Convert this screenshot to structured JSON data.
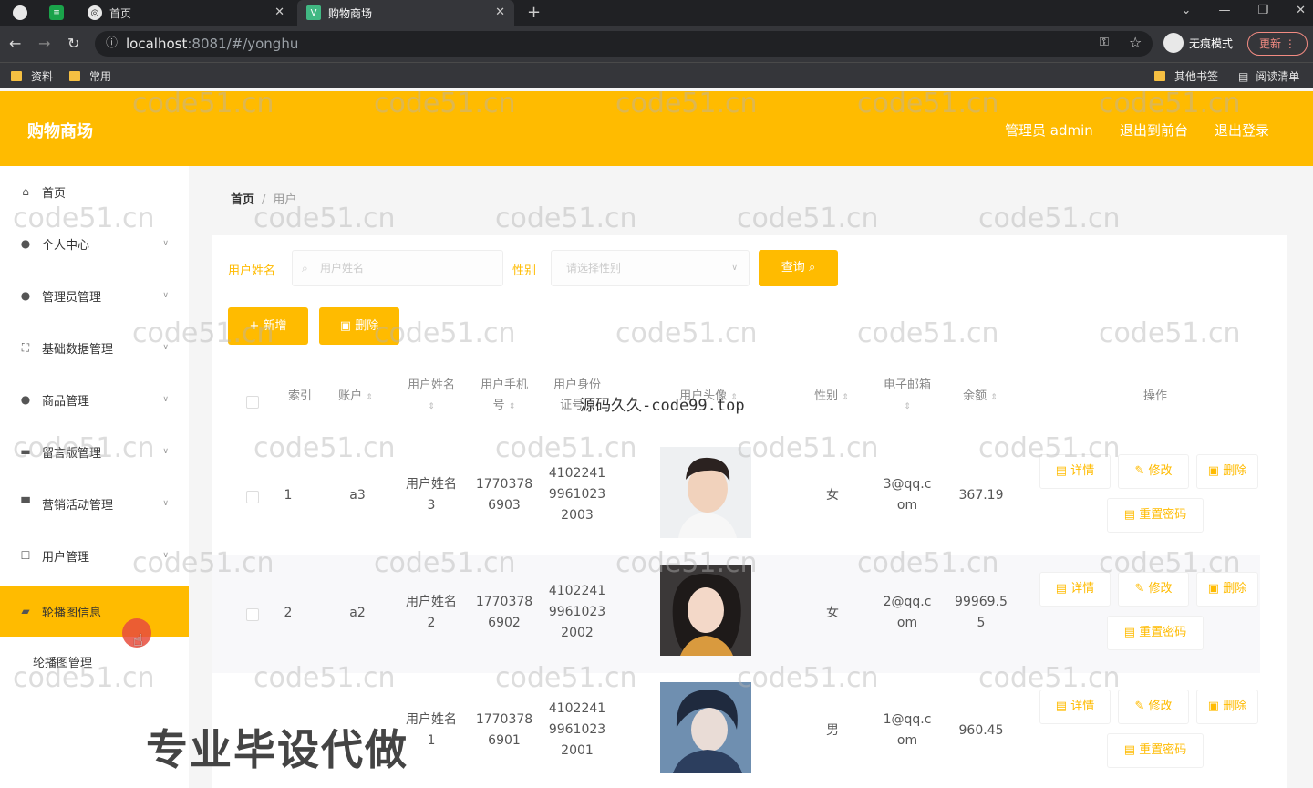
{
  "browser": {
    "tab_home": "首页",
    "tab_active": "购物商场",
    "url_host": "localhost",
    "url_rest": ":8081/#/yonghu",
    "incognito": "无痕模式",
    "update": "更新",
    "bookmarks": [
      "资料",
      "常用"
    ],
    "bookmarks_right": [
      "其他书签",
      "阅读清单"
    ]
  },
  "header": {
    "title": "购物商场",
    "admin": "管理员 admin",
    "to_front": "退出到前台",
    "logout": "退出登录"
  },
  "sidebar": {
    "items": [
      {
        "label": "首页",
        "icon": "home-icon"
      },
      {
        "label": "个人中心",
        "icon": "user-icon"
      },
      {
        "label": "管理员管理",
        "icon": "user-icon"
      },
      {
        "label": "基础数据管理",
        "icon": "expand-icon"
      },
      {
        "label": "商品管理",
        "icon": "user-icon"
      },
      {
        "label": "留言版管理",
        "icon": "message-icon"
      },
      {
        "label": "营销活动管理",
        "icon": "monitor-icon"
      },
      {
        "label": "用户管理",
        "icon": "square-icon"
      },
      {
        "label": "轮播图信息",
        "icon": "bag-icon"
      }
    ],
    "sub_item": "轮播图管理"
  },
  "breadcrumb": {
    "home": "首页",
    "sep": "/",
    "current": "用户"
  },
  "search": {
    "name_label": "用户姓名",
    "name_placeholder": "用户姓名",
    "gender_label": "性别",
    "gender_placeholder": "请选择性别",
    "query": "查询"
  },
  "actions": {
    "add": "+ 新增",
    "delete": "删除"
  },
  "table": {
    "headers": [
      "索引",
      "账户",
      "用户姓名",
      "用户手机号",
      "用户身份证号",
      "用户头像",
      "性别",
      "电子邮箱",
      "余额",
      "操作"
    ],
    "header_lines": {
      "name": [
        "用户姓名"
      ],
      "phone": [
        "用户手机",
        "号"
      ],
      "idcard": [
        "用户身份",
        "证号"
      ],
      "email": [
        "电子邮箱"
      ]
    },
    "rows": [
      {
        "index": "1",
        "account": "a3",
        "name": [
          "用户姓名",
          "3"
        ],
        "phone": [
          "1770378",
          "6903"
        ],
        "idcard": [
          "4102241",
          "9961023",
          "2003"
        ],
        "gender": "女",
        "email": [
          "3@qq.c",
          "om"
        ],
        "balance": [
          "367.19"
        ]
      },
      {
        "index": "2",
        "account": "a2",
        "name": [
          "用户姓名",
          "2"
        ],
        "phone": [
          "1770378",
          "6902"
        ],
        "idcard": [
          "4102241",
          "9961023",
          "2002"
        ],
        "gender": "女",
        "email": [
          "2@qq.c",
          "om"
        ],
        "balance": [
          "99969.5",
          "5"
        ]
      },
      {
        "index": "",
        "account": "",
        "name": [
          "用户姓名",
          "1"
        ],
        "phone": [
          "1770378",
          "6901"
        ],
        "idcard": [
          "4102241",
          "9961023",
          "2001"
        ],
        "gender": "男",
        "email": [
          "1@qq.c",
          "om"
        ],
        "balance": [
          "960.45"
        ]
      }
    ],
    "ops": {
      "detail": "详情",
      "edit": "修改",
      "delete": "删除",
      "reset": "重置密码"
    }
  },
  "overlay_text": "源码久久-code99.top",
  "promo_text": "专业毕设代做",
  "watermark": "code51.cn",
  "colors": {
    "accent": "#ffbb00",
    "chrome": "#202124"
  }
}
